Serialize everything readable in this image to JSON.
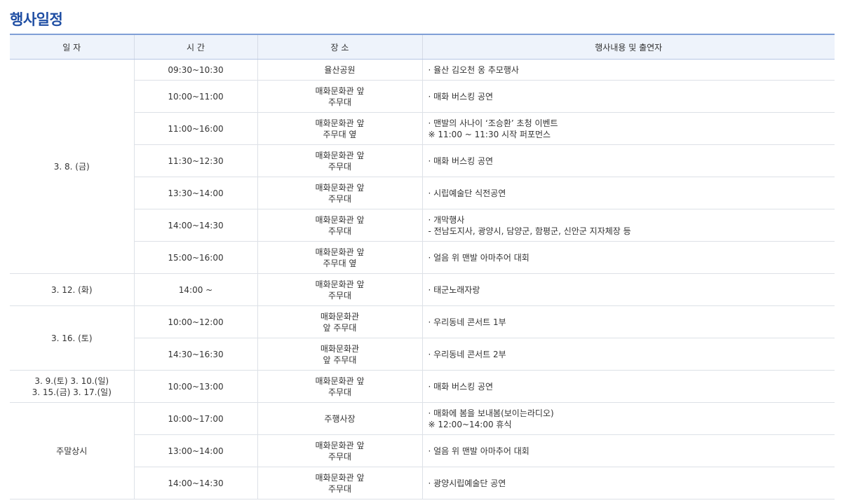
{
  "title": "행사일정",
  "headers": [
    "일 자",
    "시 간",
    "장 소",
    "행사내용 및 출연자"
  ],
  "groups": [
    {
      "date": [
        "3. 8. (금)"
      ],
      "rows": [
        {
          "time": "09:30~10:30",
          "place": [
            "율산공원"
          ],
          "desc": [
            "· 율산 김오천 옹 추모행사"
          ]
        },
        {
          "time": "10:00~11:00",
          "place": [
            "매화문화관 앞",
            "주무대"
          ],
          "desc": [
            "· 매화 버스킹 공연"
          ]
        },
        {
          "time": "11:00~16:00",
          "place": [
            "매화문화관 앞",
            "주무대 옆"
          ],
          "desc": [
            "· 맨발의 사나이 ‘조승환’ 초청 이벤트",
            "※ 11:00 ~ 11:30 시작 퍼포먼스"
          ]
        },
        {
          "time": "11:30~12:30",
          "place": [
            "매화문화관 앞",
            "주무대"
          ],
          "desc": [
            "· 매화 버스킹 공연"
          ]
        },
        {
          "time": "13:30~14:00",
          "place": [
            "매화문화관 앞",
            "주무대"
          ],
          "desc": [
            "· 시립예술단 식전공연"
          ]
        },
        {
          "time": "14:00~14:30",
          "place": [
            "매화문화관 앞",
            "주무대"
          ],
          "desc": [
            "· 개막행사",
            "- 전남도지사, 광양시, 담양군, 함평군, 신안군 지자체장 등"
          ]
        },
        {
          "time": "15:00~16:00",
          "place": [
            "매화문화관 앞",
            "주무대 옆"
          ],
          "desc": [
            "· 얼음 위 맨발 아마추어 대회"
          ]
        }
      ]
    },
    {
      "date": [
        "3. 12. (화)"
      ],
      "rows": [
        {
          "time": "14:00 ~",
          "place": [
            "매화문화관 앞",
            "주무대"
          ],
          "desc": [
            "· 태군노래자랑"
          ]
        }
      ]
    },
    {
      "date": [
        "3. 16. (토)"
      ],
      "rows": [
        {
          "time": "10:00~12:00",
          "place": [
            "매화문화관",
            "앞 주무대"
          ],
          "desc": [
            "· 우리동네 콘서트 1부"
          ]
        },
        {
          "time": "14:30~16:30",
          "place": [
            "매화문화관",
            "앞 주무대"
          ],
          "desc": [
            "· 우리동네 콘서트 2부"
          ]
        }
      ]
    },
    {
      "date": [
        "3. 9.(토) 3. 10.(일)",
        "3. 15.(금) 3. 17.(일)"
      ],
      "rows": [
        {
          "time": "10:00~13:00",
          "place": [
            "매화문화관 앞",
            "주무대"
          ],
          "desc": [
            "· 매화 버스킹 공연"
          ]
        }
      ]
    },
    {
      "date": [
        "주말상시"
      ],
      "rows": [
        {
          "time": "10:00~17:00",
          "place": [
            "주행사장"
          ],
          "desc": [
            "· 매화에 봄을 보내봄(보이는라디오)",
            "※ 12:00~14:00 휴식"
          ]
        },
        {
          "time": "13:00~14:00",
          "place": [
            "매화문화관 앞",
            "주무대"
          ],
          "desc": [
            "· 얼음 위 맨발 아마추어 대회"
          ]
        },
        {
          "time": "14:00~14:30",
          "place": [
            "매화문화관 앞",
            "주무대"
          ],
          "desc": [
            "· 광양시립예술단 공연"
          ]
        }
      ]
    }
  ]
}
